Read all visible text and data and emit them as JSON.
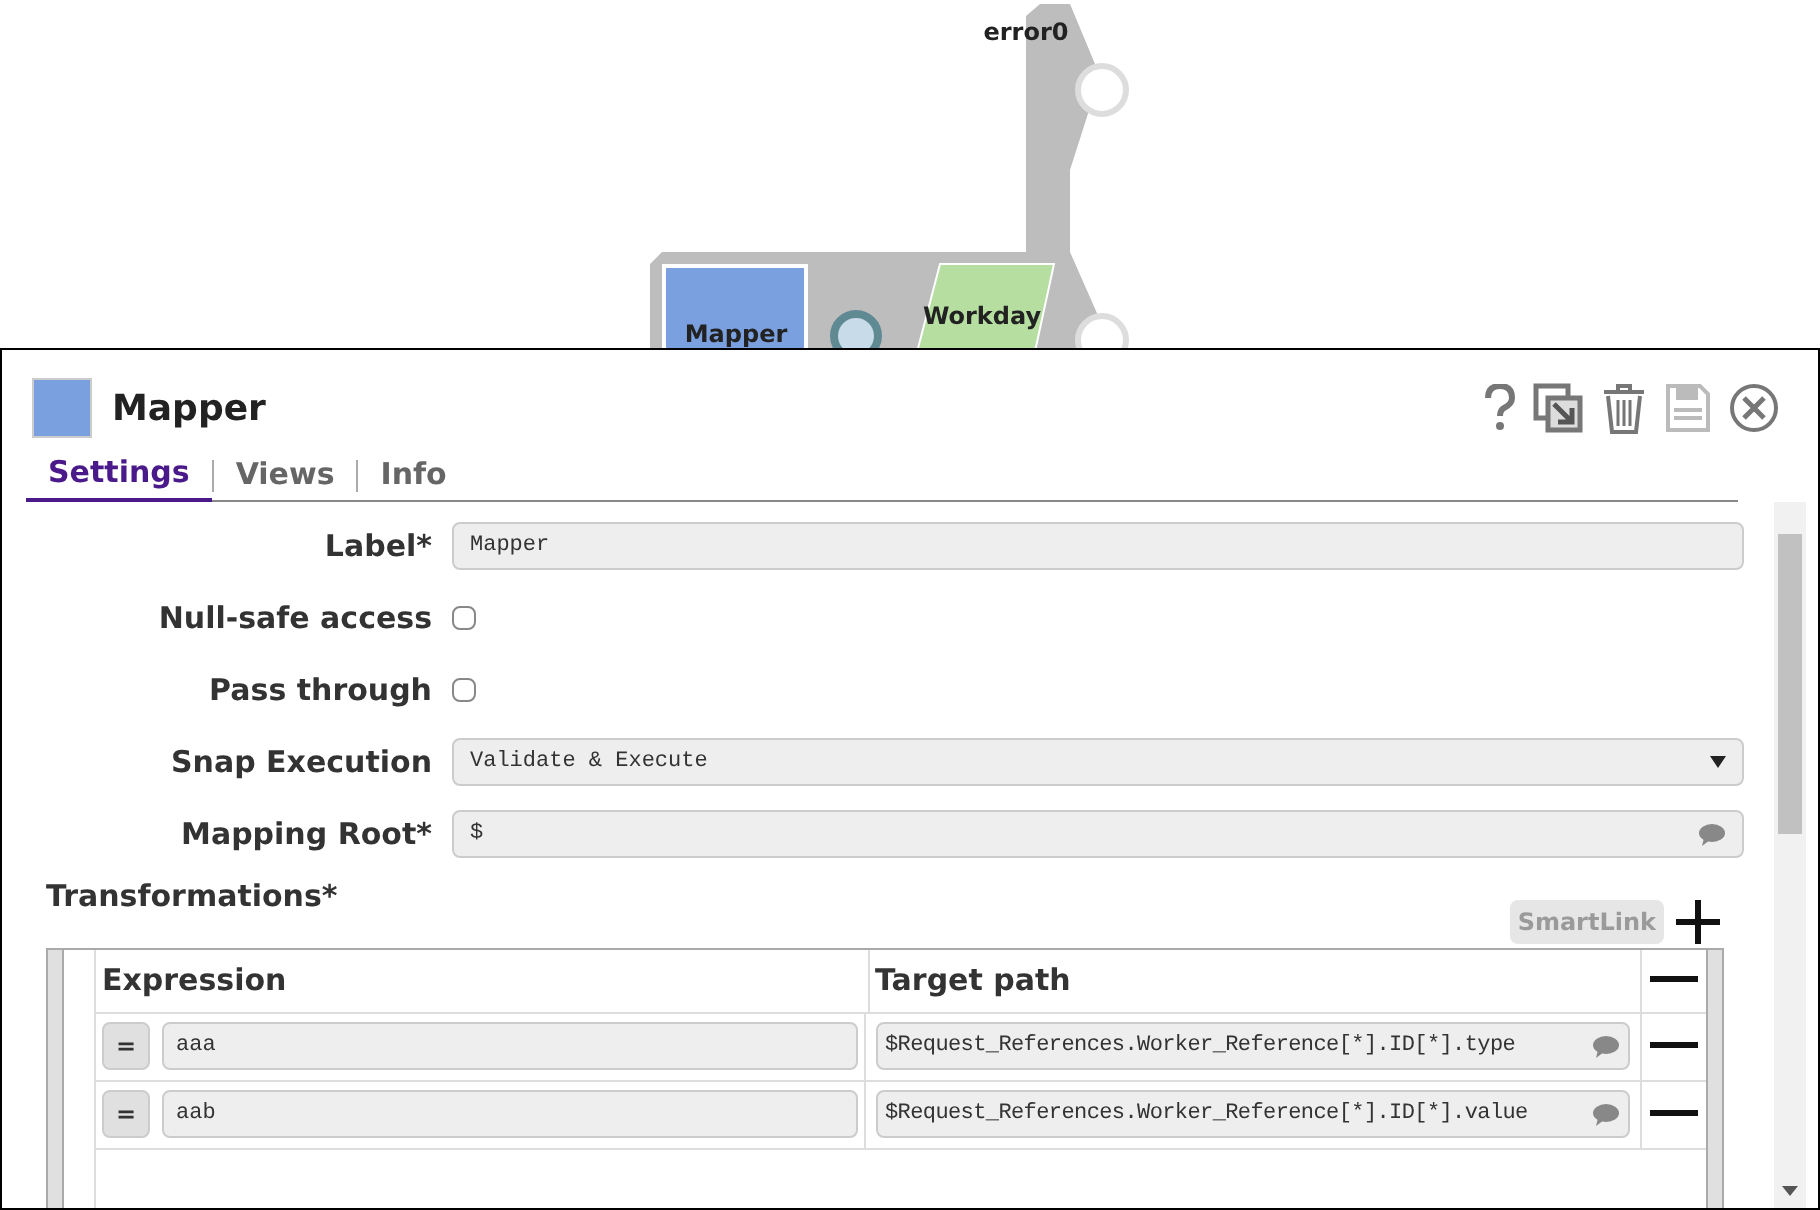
{
  "canvas": {
    "error_label": "error0",
    "nodes": [
      {
        "kind": "mapper",
        "label": "Mapper"
      },
      {
        "kind": "reader",
        "label": "Workday"
      }
    ]
  },
  "dialog": {
    "title": "Mapper",
    "tabs": [
      {
        "label": "Settings",
        "selected": true
      },
      {
        "label": "Views",
        "selected": false
      },
      {
        "label": "Info",
        "selected": false
      }
    ],
    "fields": [
      {
        "kind": "text",
        "label": "Label*",
        "value": "Mapper"
      },
      {
        "kind": "checkbox",
        "label": "Null-safe access",
        "checked": false
      },
      {
        "kind": "checkbox",
        "label": "Pass through",
        "checked": false
      },
      {
        "kind": "select",
        "label": "Snap Execution",
        "value": "Validate & Execute"
      },
      {
        "kind": "expression",
        "label": "Mapping Root*",
        "value": "$"
      }
    ],
    "transformations": {
      "title": "Transformations*",
      "smartlink": {
        "label": "SmartLink",
        "disabled": true
      },
      "columns": [
        "Expression",
        "Target path"
      ],
      "rows": [
        {
          "operator": "=",
          "expression": "aaa",
          "target": "$Request_References.Worker_Reference[*].ID[*].type"
        },
        {
          "operator": "=",
          "expression": "aab",
          "target": "$Request_References.Worker_Reference[*].ID[*].value"
        }
      ]
    }
  }
}
